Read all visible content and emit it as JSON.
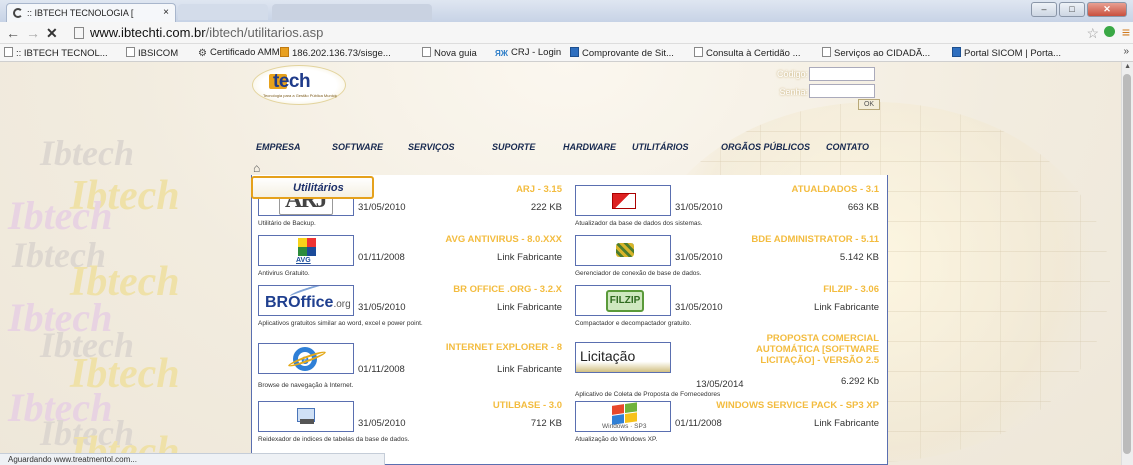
{
  "browser": {
    "tab_title": ":: IBTECH TECNOLOGIA [",
    "tab_close": "×",
    "url_domain": "www.ibtechti.com.br",
    "url_path": "/ibtech/utilitarios.asp",
    "bookmarks": [
      ":: IBTECH TECNOL...",
      "IBSICOM",
      "Certificado AMM",
      "186.202.136.73/sisge...",
      "Nova guia",
      "CRJ - Login",
      "Comprovante de Sit...",
      "Consulta à Certidão ...",
      "Serviços ao CIDADÃ...",
      "Portal SICOM | Porta..."
    ],
    "bookmarks_more": "»",
    "status_text": "Aguardando www.treatmentol.com..."
  },
  "header": {
    "logo_text": "tech",
    "logo_tagline": "Tecnologia para a Gestão Pública Municipal",
    "login": {
      "code_label": "Código:",
      "password_label": "Senha:",
      "ok_label": "OK"
    }
  },
  "nav": [
    "EMPRESA",
    "SOFTWARE",
    "SERVIÇOS",
    "SUPORTE",
    "HARDWARE",
    "UTILITÁRIOS",
    "ORGÃOS PÚBLICOS",
    "CONTATO"
  ],
  "section_title": "Utilitários",
  "watermark_text": "Ibtech",
  "items": [
    {
      "title": "ARJ - 3.15",
      "date": "31/05/2010",
      "size": "222 KB",
      "desc": "Utilitário de Backup."
    },
    {
      "title": "ATUALDADOS - 3.1",
      "date": "31/05/2010",
      "size": "663 KB",
      "desc": "Atualizador da base de dados dos sistemas."
    },
    {
      "title": "AVG ANTIVIRUS - 8.0.XXX",
      "date": "01/11/2008",
      "size": "Link Fabricante",
      "desc": "Antivirus Gratuito.",
      "thumb_text": "AVG"
    },
    {
      "title": "BDE ADMINISTRATOR - 5.11",
      "date": "31/05/2010",
      "size": "5.142 KB",
      "desc": "Gerenciador de conexão de base de dados."
    },
    {
      "title": "BR OFFICE .ORG - 3.2.X",
      "date": "31/05/2010",
      "size": "Link Fabricante",
      "desc": "Aplicativos gratuitos similar ao word, excel e power point.",
      "thumb_text": "BROffice",
      "thumb_suffix": ".org"
    },
    {
      "title": "FILZIP - 3.06",
      "date": "31/05/2010",
      "size": "Link Fabricante",
      "desc": "Compactador e decompactador gratuito.",
      "thumb_text": "FILZIP"
    },
    {
      "title": "INTERNET EXPLORER - 8",
      "date": "01/11/2008",
      "size": "Link Fabricante",
      "desc": "Browse de navegação à Internet."
    },
    {
      "title": "PROPOSTA COMERCIAL AUTOMÁTICA [SOFTWARE LICITAÇÃO] - VERSÃO 2.5",
      "date": "13/05/2014",
      "size": "6.292 Kb",
      "desc": "Aplicativo de Coleta de Proposta de Fornecedores",
      "thumb_text": "Licitação"
    },
    {
      "title": "UTILBASE - 3.0",
      "date": "31/05/2010",
      "size": "712 KB",
      "desc": "Reidexador de indices de tabelas da base de dados."
    },
    {
      "title": "WINDOWS SERVICE PACK - SP3 XP",
      "date": "01/11/2008",
      "size": "Link Fabricante",
      "desc": "Atualização do Windows XP.",
      "thumb_text": "Windows",
      "thumb_suffix": "SP3"
    }
  ],
  "colors": {
    "item_title": "#f3bc3f",
    "nav_text": "#16284f",
    "content_border": "#5a6fb0",
    "section_tab_border": "#e5a11c"
  }
}
